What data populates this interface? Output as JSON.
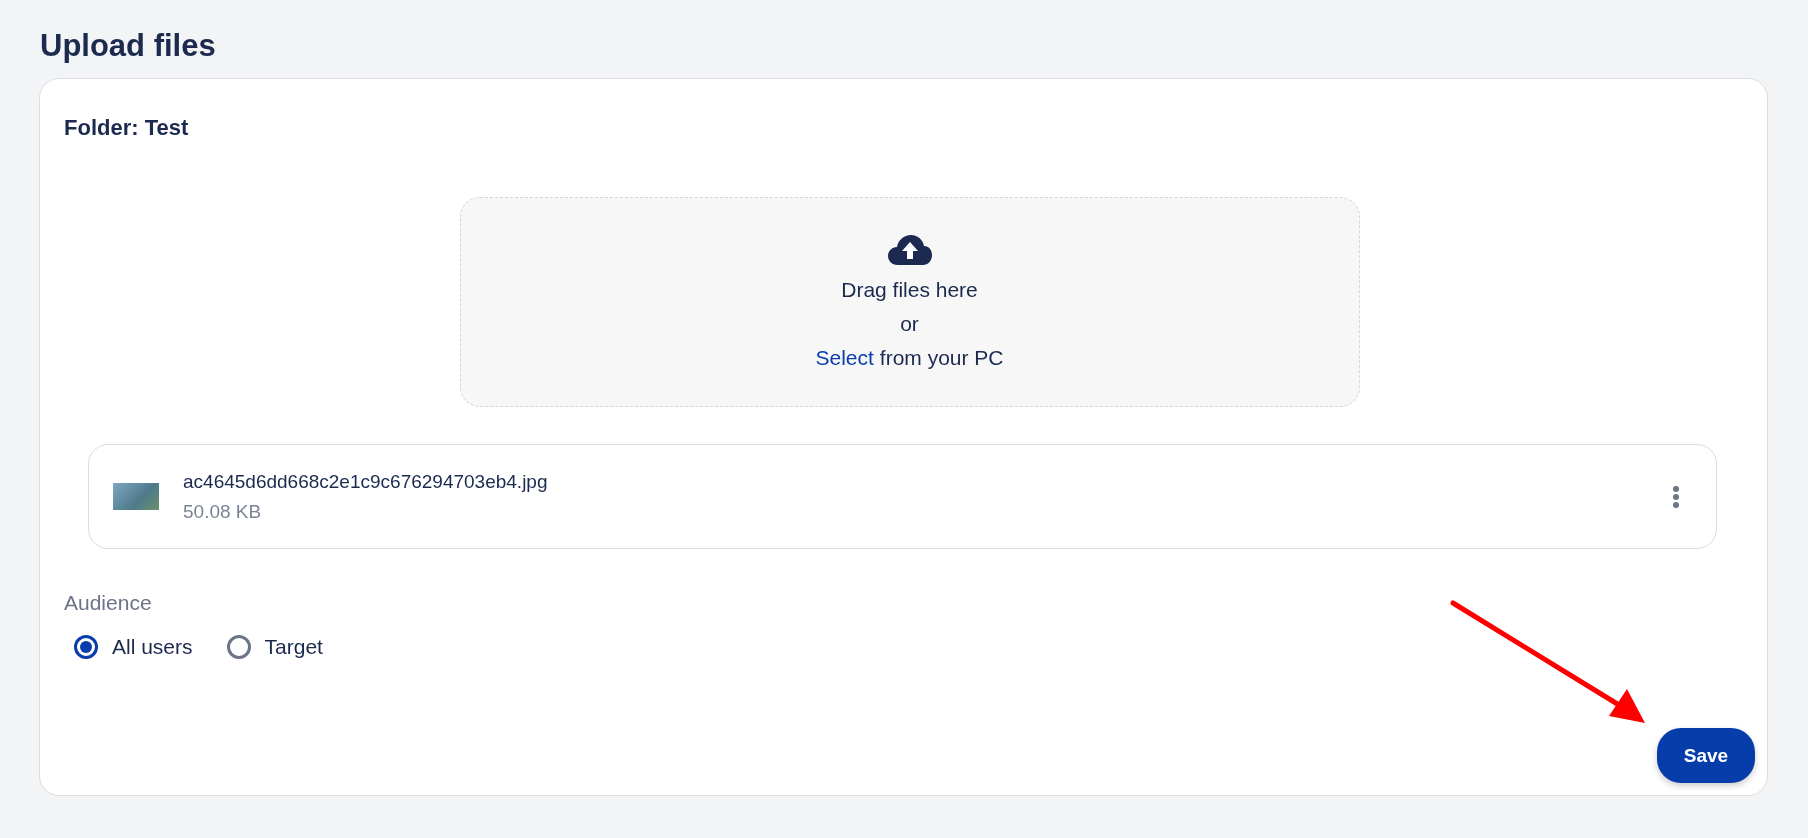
{
  "page": {
    "title": "Upload files"
  },
  "folder": {
    "label": "Folder: Test"
  },
  "dropzone": {
    "line_1": "Drag files here",
    "line_2": "or",
    "link": "Select",
    "line_3_rest": "from your PC"
  },
  "files": [
    {
      "name": "ac4645d6dd668c2e1c9c676294703eb4.jpg",
      "size": "50.08 KB"
    }
  ],
  "audience": {
    "label": "Audience",
    "options": [
      {
        "label": "All users",
        "selected": true
      },
      {
        "label": "Target",
        "selected": false
      }
    ]
  },
  "buttons": {
    "save": "Save"
  }
}
